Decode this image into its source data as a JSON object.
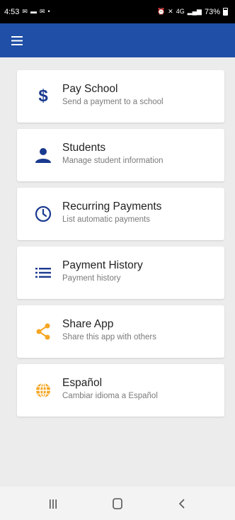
{
  "status_bar": {
    "time": "4:53",
    "battery": "73%",
    "signal": "4G"
  },
  "app_bar": {
    "menu_icon": "hamburger-icon",
    "color": "#1f4fa6"
  },
  "menu": {
    "items": [
      {
        "title": "Pay School",
        "subtitle": "Send a payment to a school",
        "icon": "dollar-icon",
        "icon_color": "#1a3a8f"
      },
      {
        "title": "Students",
        "subtitle": "Manage student information",
        "icon": "person-icon",
        "icon_color": "#1a3a8f"
      },
      {
        "title": "Recurring Payments",
        "subtitle": "List automatic payments",
        "icon": "clock-icon",
        "icon_color": "#1a3a8f"
      },
      {
        "title": "Payment History",
        "subtitle": "Payment history",
        "icon": "list-icon",
        "icon_color": "#1a3a8f"
      },
      {
        "title": "Share App",
        "subtitle": "Share this app with others",
        "icon": "share-icon",
        "icon_color": "#f5a623"
      },
      {
        "title": "Español",
        "subtitle": "Cambiar idioma a Español",
        "icon": "globe-icon",
        "icon_color": "#f5a623"
      }
    ]
  },
  "nav_bar": {
    "recents_icon": "recents-icon",
    "home_icon": "home-icon",
    "back_icon": "back-icon"
  }
}
